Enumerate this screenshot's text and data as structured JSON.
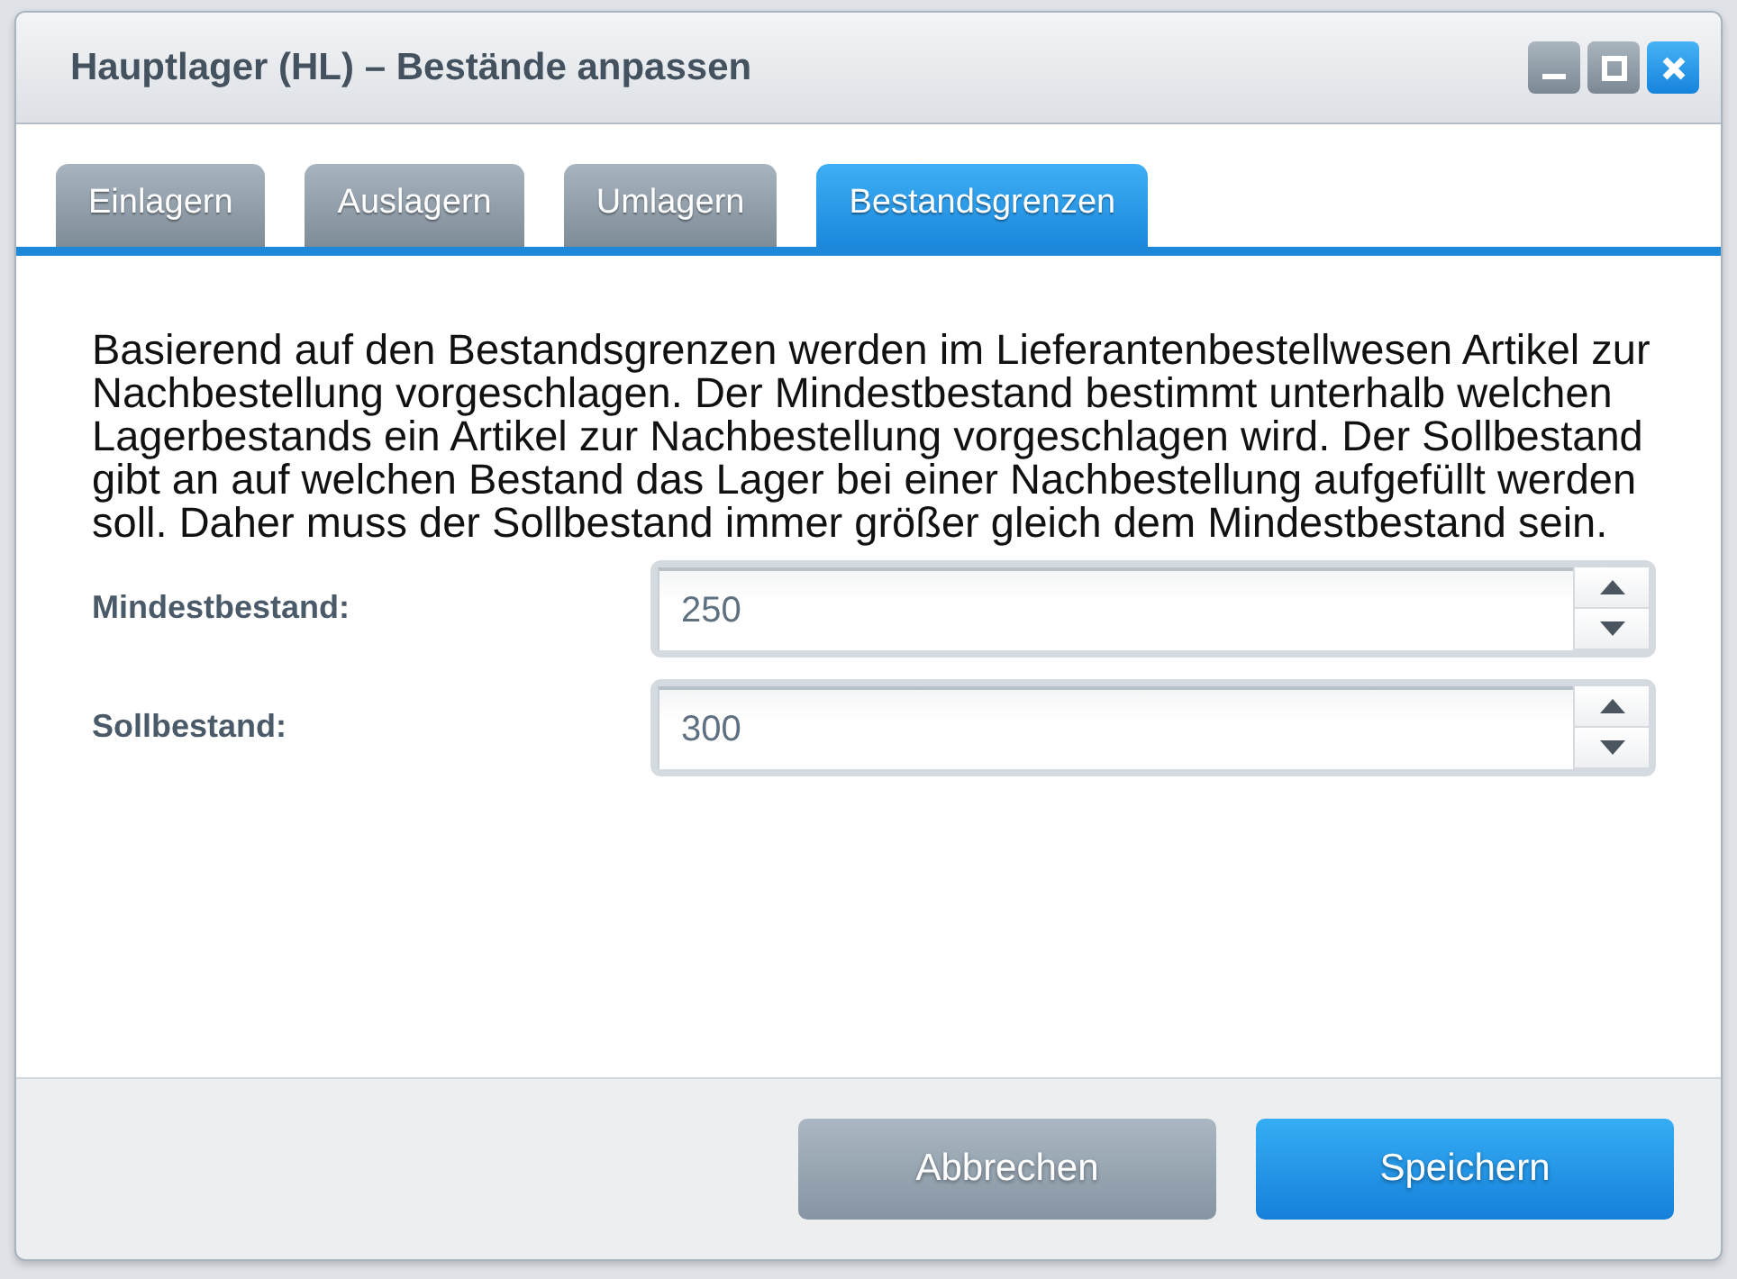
{
  "window": {
    "title": "Hauptlager (HL) – Bestände anpassen",
    "controls": [
      {
        "kind": "minimize"
      },
      {
        "kind": "maximize"
      },
      {
        "kind": "close"
      }
    ]
  },
  "tabs": [
    {
      "label": "Einlagern",
      "selected": false
    },
    {
      "label": "Auslagern",
      "selected": false
    },
    {
      "label": "Umlagern",
      "selected": false
    },
    {
      "label": "Bestandsgrenzen",
      "selected": true
    }
  ],
  "description": "Basierend auf den Bestandsgrenzen werden im Lieferantenbestellwesen Artikel zur Nachbestellung vorgeschlagen. Der Mindestbestand bestimmt unterhalb welchen Lagerbestands ein Artikel zur Nachbestellung vorgeschlagen wird. Der Sollbestand gibt an auf welchen Bestand das Lager bei einer Nachbestellung aufgefüllt werden soll. Daher muss der Sollbestand immer größer gleich dem Mindestbestand sein.",
  "fields": [
    {
      "label": "Mindestbestand:",
      "value": "250"
    },
    {
      "label": "Sollbestand:",
      "value": "300"
    }
  ],
  "buttons": [
    {
      "label": "Abbrechen",
      "kind": "secondary"
    },
    {
      "label": "Speichern",
      "kind": "primary"
    }
  ]
}
